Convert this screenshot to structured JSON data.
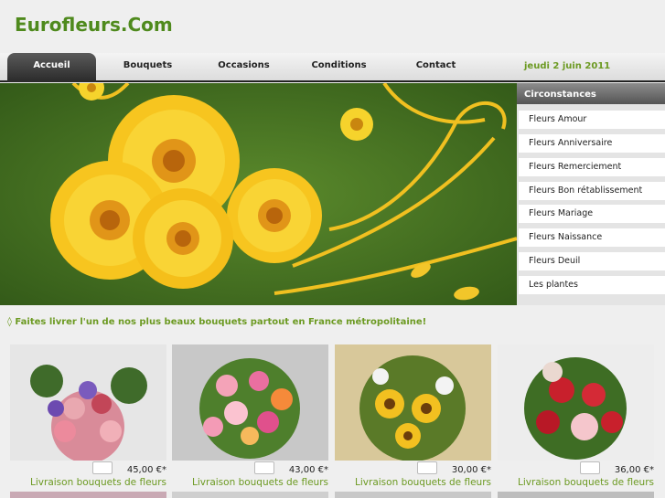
{
  "site": {
    "logo": "Eurofleurs.Com"
  },
  "nav": {
    "tabs": [
      {
        "label": "Accueil"
      },
      {
        "label": "Bouquets"
      },
      {
        "label": "Occasions"
      },
      {
        "label": "Conditions"
      },
      {
        "label": "Contact"
      }
    ],
    "active_index": 0,
    "date": "jeudi 2 juin 2011"
  },
  "sidebar": {
    "title": "Circonstances",
    "items": [
      {
        "label": "Fleurs Amour"
      },
      {
        "label": "Fleurs Anniversaire"
      },
      {
        "label": "Fleurs Remerciement"
      },
      {
        "label": "Fleurs Bon rétablissement"
      },
      {
        "label": "Fleurs Mariage"
      },
      {
        "label": "Fleurs Naissance"
      },
      {
        "label": "Fleurs Deuil"
      },
      {
        "label": "Les plantes"
      }
    ]
  },
  "tagline": "◊ Faites livrer l'un de nos plus beaux bouquets partout en France métropolitaine!",
  "products": [
    {
      "price": "45,00 €*",
      "link": "Livraison bouquets de fleurs"
    },
    {
      "price": "43,00 €*",
      "link": "Livraison bouquets de fleurs"
    },
    {
      "price": "30,00 €*",
      "link": "Livraison bouquets de fleurs"
    },
    {
      "price": "36,00 €*",
      "link": "Livraison bouquets de fleurs"
    }
  ],
  "colors": {
    "brand_green": "#4f8a1d",
    "accent_green": "#6c9a22",
    "nav_active": "#333333"
  }
}
